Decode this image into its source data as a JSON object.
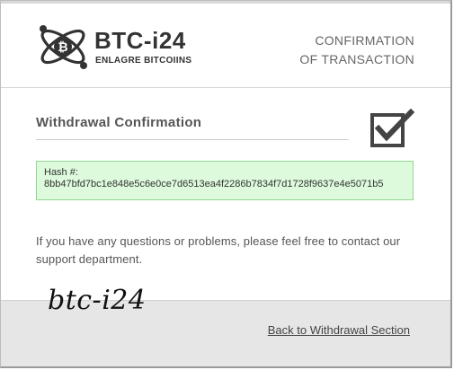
{
  "header": {
    "brand_name": "BTC-i24",
    "tagline": "ENLAGRE BITCOIINS",
    "right_line1": "CONFIRMATION",
    "right_line2": "OF TRANSACTION"
  },
  "main": {
    "title": "Withdrawal Confirmation",
    "hash_label": "Hash #:",
    "hash_value": "8bb47bfd7bc1e848e5c6e0ce7d6513ea4f2286b7834f7d1728f9637e4e5071b5",
    "help_text": "If you have any questions or problems, please feel free to contact our support department."
  },
  "footer": {
    "signature": "btc-i24",
    "back_link": "Back to Withdrawal Section"
  },
  "icons": {
    "logo": "atom-logo-icon",
    "check": "checkbox-checked-icon"
  },
  "colors": {
    "hash_bg": "#ddfadd",
    "hash_border": "#91d891",
    "footer_bg": "#e6e6e6"
  }
}
